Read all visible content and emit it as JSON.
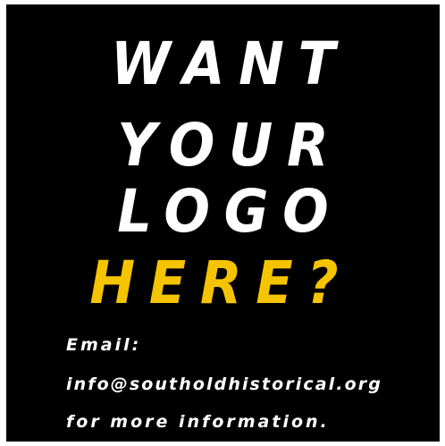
{
  "ad": {
    "headline": [
      "WANT",
      "YOUR",
      "LOGO",
      "HERE?"
    ],
    "contact": {
      "email_label": "Email:",
      "email_address": "info@southoldhistorical.org",
      "closing": "for more information."
    }
  },
  "colors": {
    "background": "#000000",
    "text": "#ffffff",
    "accent": "#f5c400"
  }
}
